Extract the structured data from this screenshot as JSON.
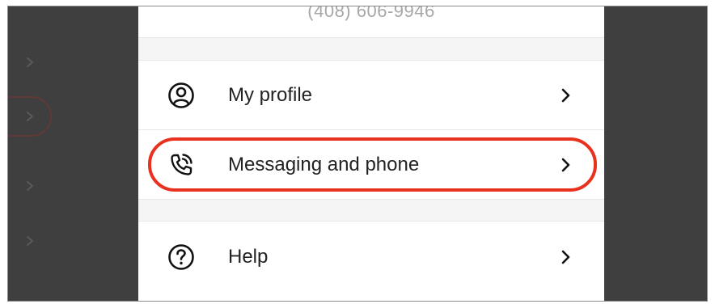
{
  "app": {
    "phone_number": "(408) 606-9946"
  },
  "menu": {
    "items": [
      {
        "label": "My profile",
        "icon": "user-circle-icon"
      },
      {
        "label": "Messaging and phone",
        "icon": "phone-call-icon",
        "highlighted": true
      },
      {
        "label": "Help",
        "icon": "question-circle-icon"
      }
    ]
  },
  "colors": {
    "highlight": "#e8321f",
    "overlay": "#3f3f3f",
    "text": "#222222",
    "muted_text": "#a7a7a7"
  }
}
